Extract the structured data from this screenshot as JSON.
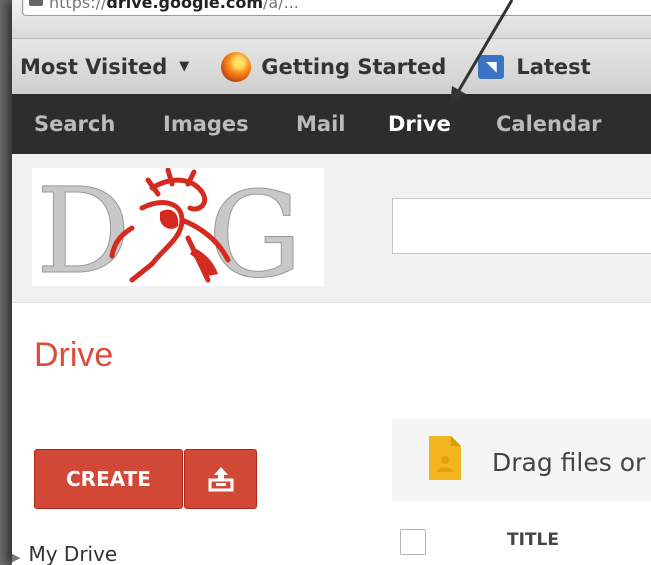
{
  "browser": {
    "url_prefix": "https://",
    "url_domain": "drive.google.com",
    "url_suffix": "/a/...",
    "bookmarks": [
      {
        "label": "Most Visited",
        "icon": "chevron-down-icon"
      },
      {
        "label": "Getting Started",
        "icon": "firefox-icon"
      },
      {
        "label": "Latest",
        "icon": "rss-feed-icon"
      }
    ]
  },
  "google_bar": {
    "items": [
      {
        "label": "Search",
        "active": false
      },
      {
        "label": "Images",
        "active": false
      },
      {
        "label": "Mail",
        "active": false
      },
      {
        "label": "Drive",
        "active": true
      },
      {
        "label": "Calendar",
        "active": false
      }
    ]
  },
  "header": {
    "logo_text": "DG"
  },
  "drive": {
    "title": "Drive",
    "create_label": "CREATE",
    "upload_icon": "upload-icon",
    "my_drive_label": "My Drive",
    "drop_text": "Drag files or",
    "title_column": "TITLE"
  },
  "colors": {
    "accent": "#dd4b39",
    "button": "#d14836",
    "google_bar": "#2d2d2d"
  }
}
